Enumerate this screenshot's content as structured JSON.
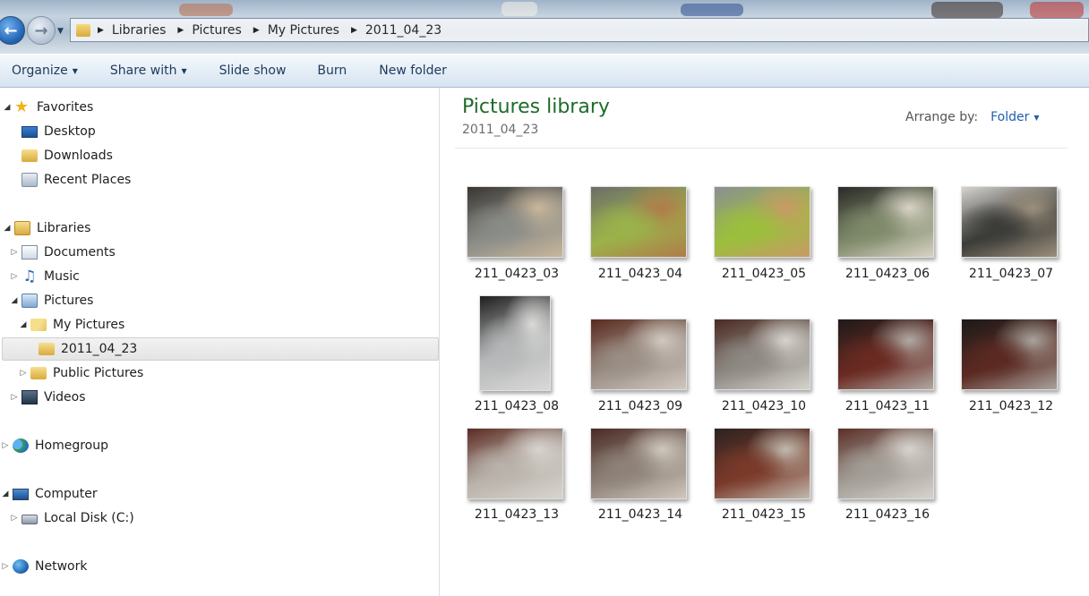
{
  "address": {
    "crumbs": [
      "Libraries",
      "Pictures",
      "My Pictures",
      "2011_04_23"
    ]
  },
  "toolbar": {
    "organize": "Organize",
    "share_with": "Share with",
    "slide_show": "Slide show",
    "burn": "Burn",
    "new_folder": "New folder"
  },
  "nav": {
    "favorites": "Favorites",
    "desktop": "Desktop",
    "downloads": "Downloads",
    "recent_places": "Recent Places",
    "libraries": "Libraries",
    "documents": "Documents",
    "music": "Music",
    "pictures": "Pictures",
    "my_pictures": "My Pictures",
    "current_folder": "2011_04_23",
    "public_pictures": "Public Pictures",
    "videos": "Videos",
    "homegroup": "Homegroup",
    "computer": "Computer",
    "local_disk": "Local Disk (C:)",
    "network": "Network"
  },
  "content": {
    "title": "Pictures library",
    "subtitle": "2011_04_23",
    "arrange_label": "Arrange by:",
    "arrange_value": "Folder"
  },
  "files": [
    {
      "name": "211_0423_03",
      "tone": [
        "#3a3632",
        "#8a8c88",
        "#c9b69a"
      ]
    },
    {
      "name": "211_0423_04",
      "tone": [
        "#6b6d6a",
        "#9bb24a",
        "#b07c4a"
      ]
    },
    {
      "name": "211_0423_05",
      "tone": [
        "#8a8f92",
        "#9bbf3c",
        "#c89a66"
      ]
    },
    {
      "name": "211_0423_06",
      "tone": [
        "#2a2a28",
        "#7f8a6a",
        "#d8d2c4"
      ]
    },
    {
      "name": "211_0423_07",
      "tone": [
        "#d7d4cf",
        "#3b3b38",
        "#9b8f7c"
      ]
    },
    {
      "name": "211_0423_08",
      "tone": [
        "#1f1f1e",
        "#b5b7b8",
        "#d9d9d7"
      ]
    },
    {
      "name": "211_0423_09",
      "tone": [
        "#5a2b1f",
        "#9b8f86",
        "#d0c8bf"
      ]
    },
    {
      "name": "211_0423_10",
      "tone": [
        "#4a2a22",
        "#8f8a84",
        "#d6d2cc"
      ]
    },
    {
      "name": "211_0423_11",
      "tone": [
        "#1e1a19",
        "#6a2a22",
        "#b0aaa4"
      ]
    },
    {
      "name": "211_0423_12",
      "tone": [
        "#1c1a19",
        "#5b2a22",
        "#a8a39c"
      ]
    },
    {
      "name": "211_0423_13",
      "tone": [
        "#5b2b22",
        "#b9b3ab",
        "#d8d4ce"
      ]
    },
    {
      "name": "211_0423_14",
      "tone": [
        "#4a2b25",
        "#8f8379",
        "#cfc7bd"
      ]
    },
    {
      "name": "211_0423_15",
      "tone": [
        "#2b2220",
        "#7a3a2a",
        "#c1b9ae"
      ]
    },
    {
      "name": "211_0423_16",
      "tone": [
        "#5a2f26",
        "#a49f98",
        "#d7d3cd"
      ]
    }
  ]
}
